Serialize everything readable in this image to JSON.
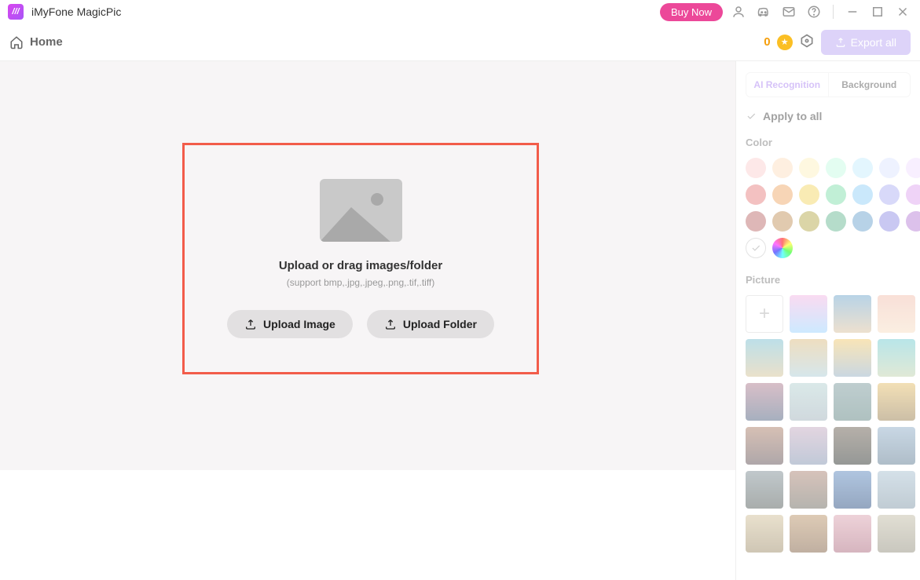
{
  "app": {
    "title": "iMyFone MagicPic",
    "buy_now": "Buy Now"
  },
  "nav": {
    "home": "Home"
  },
  "header": {
    "count": "0",
    "export_all": "Export all"
  },
  "upload": {
    "title": "Upload or drag images/folder",
    "subtitle": "(support bmp,.jpg,.jpeg,.png,.tif,.tiff)",
    "image_btn": "Upload Image",
    "folder_btn": "Upload Folder"
  },
  "sidebar": {
    "tabs": {
      "recognition": "AI Recognition",
      "background": "Background"
    },
    "apply_all": "Apply to all",
    "color_label": "Color",
    "picture_label": "Picture",
    "colors": [
      "#fbd5d5",
      "#fde2c7",
      "#fef3c7",
      "#ccfbe6",
      "#cdeefd",
      "#e0e7ff",
      "#f3e2ff",
      "#e98f8f",
      "#f0b27a",
      "#f5da77",
      "#8ee2b5",
      "#9fd6f7",
      "#b8baf5",
      "#e2b0f0",
      "#c47d7d",
      "#c99e6e",
      "#bdb35f",
      "#78bf9e",
      "#7caed4",
      "#9d9ce8",
      "#c08edb"
    ]
  }
}
